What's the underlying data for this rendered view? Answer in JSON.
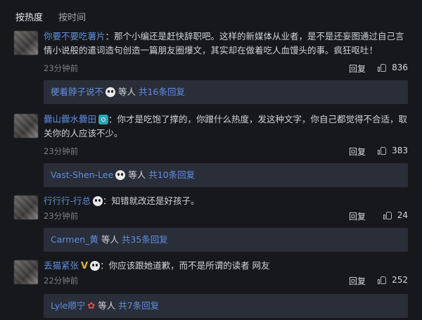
{
  "tabs": [
    {
      "label": "按热度"
    },
    {
      "label": "按时间"
    }
  ],
  "comments": [
    {
      "user": "你要不要吃薯片",
      "text": "：那个小编还是赶快辞职吧。这样的新媒体从业者，是不是还妄图通过自己言情小说般的遣词造句创造一篇朋友圈爆文，其实却在做着吃人血馒头的事。疯狂呕吐！",
      "time": "23分钟前",
      "reply_label": "回复",
      "likes": "836",
      "thread": {
        "name": "梗着脖子说不",
        "mid": " 等人 ",
        "count": "共16条回复"
      }
    },
    {
      "user": "爨山爨水爨田",
      "text": "：你才是吃饱了撑的，你蹭什么热度，发这种文字，你自己都觉得不合适，取关你的人应该不少。",
      "time": "23分钟前",
      "reply_label": "回复",
      "likes": "383",
      "thread": {
        "name": "Vast-Shen-Lee",
        "mid": " 等人 ",
        "count": "共10条回复"
      }
    },
    {
      "user": "行行行-行总",
      "text": "：知错就改还是好孩子。",
      "time": "23分钟前",
      "reply_label": "回复",
      "likes": "24",
      "thread": {
        "name": "Carmen_黄",
        "mid": " 等人 ",
        "count": "共35条回复"
      }
    },
    {
      "user": "丢猫紧张",
      "text": "：你应该跟她道歉，而不是所谓的读者 网友",
      "time": "22分钟前",
      "reply_label": "回复",
      "likes": "252",
      "thread": {
        "name": "Lyle顺宁",
        "mid": " 等人 ",
        "count": "共7条回复"
      }
    }
  ],
  "icons": {
    "badge_panda": "panda-icon",
    "badge_camera": "camera-icon",
    "badge_v": "V",
    "badge_flower": "✿",
    "like": "thumbs-up-icon"
  },
  "colors": {
    "background": "#17181c",
    "link": "#5f8ee0",
    "reply_box": "#2a2e38"
  }
}
